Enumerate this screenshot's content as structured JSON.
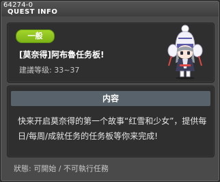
{
  "window": {
    "quest_id": "64274-0",
    "title": "QUEST INFO"
  },
  "quest": {
    "category": "一般",
    "name": "[莫奈得]阿布魯任务板!",
    "level": "建議等级: 33~37",
    "npc_icon": "snow-girl-npc-icon"
  },
  "content": {
    "header": "内容",
    "description": "快来开启莫奈得的第一个故事“红雪和少女”，提供每日/每周/成就任务的任务板等你来完成!"
  },
  "status": {
    "text": "狀態: 可開始 / 不可執行任務"
  },
  "colors": {
    "category_badge": "#8cc41d",
    "content_header": "#57626a"
  }
}
